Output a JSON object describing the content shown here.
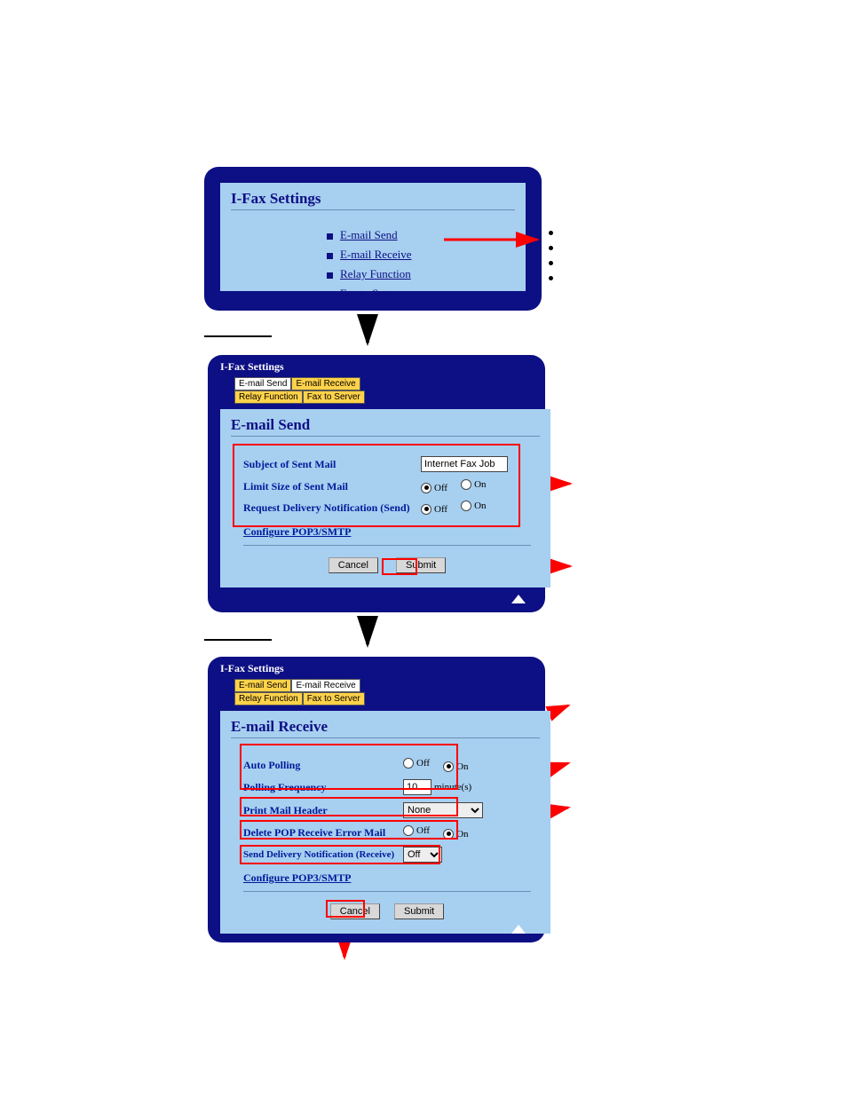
{
  "panel1": {
    "title": "I-Fax Settings",
    "items": [
      "E-mail Send",
      "E-mail Receive",
      "Relay Function",
      "Fax to Server"
    ]
  },
  "panel2": {
    "crumb": "I-Fax Settings",
    "tabs": [
      "E-mail Send",
      "E-mail Receive",
      "Relay Function",
      "Fax to Server"
    ],
    "selected_tab": 0,
    "title": "E-mail Send",
    "subject_label": "Subject of Sent Mail",
    "subject_value": "Internet Fax Job",
    "limit_label": "Limit Size of Sent Mail",
    "rdn_label": "Request Delivery Notification (Send)",
    "off": "Off",
    "on": "On",
    "conf_link": "Configure POP3/SMTP",
    "cancel": "Cancel",
    "submit": "Submit"
  },
  "panel3": {
    "crumb": "I-Fax Settings",
    "tabs": [
      "E-mail Send",
      "E-mail Receive",
      "Relay Function",
      "Fax to Server"
    ],
    "selected_tab": 1,
    "title": "E-mail Receive",
    "auto_polling_label": "Auto Polling",
    "polling_freq_label": "Polling Frequency",
    "polling_value": "10",
    "polling_unit": "minute(s)",
    "print_header_label": "Print Mail Header",
    "print_header_value": "None",
    "delete_err_label": "Delete POP Receive Error Mail",
    "sdn_label": "Send Delivery Notification (Receive)",
    "sdn_value": "Off",
    "off": "Off",
    "on": "On",
    "conf_link": "Configure POP3/SMTP",
    "cancel": "Cancel",
    "submit": "Submit"
  }
}
